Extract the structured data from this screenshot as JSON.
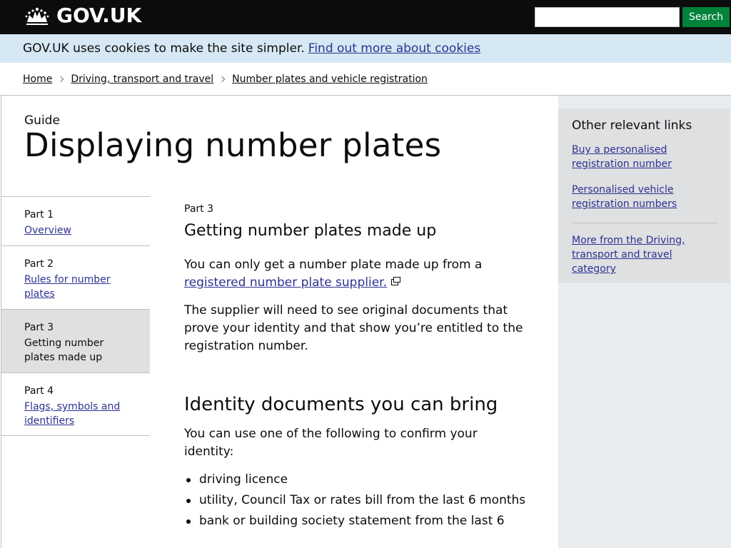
{
  "header": {
    "logo_text": "GOV.UK",
    "search": {
      "placeholder": "",
      "value": "",
      "button_label": "Search"
    }
  },
  "cookie_banner": {
    "text": "GOV.UK uses cookies to make the site simpler.",
    "link": "Find out more about cookies"
  },
  "breadcrumb": {
    "items": [
      "Home",
      "Driving, transport and travel",
      "Number plates and vehicle registration"
    ]
  },
  "title_block": {
    "label": "Guide",
    "title": "Displaying number plates"
  },
  "parts_nav": {
    "items": [
      {
        "part": "Part 1",
        "label": "Overview",
        "current": false
      },
      {
        "part": "Part 2",
        "label": "Rules for number plates",
        "current": false
      },
      {
        "part": "Part 3",
        "label": "Getting number plates made up",
        "current": true
      },
      {
        "part": "Part 4",
        "label": "Flags, symbols and identifiers",
        "current": false
      }
    ]
  },
  "content": {
    "part_label": "Part 3",
    "heading": "Getting number plates made up",
    "para1_text": "You can only get a number plate made up from a",
    "para1_link": "registered number plate supplier.",
    "para2": "The supplier will need to see original documents that prove your identity and that show you’re entitled to the registration number.",
    "heading2": "Identity documents you can bring",
    "para3": "You can use one of the following to confirm your identity:",
    "list": [
      "driving licence",
      "utility, Council Tax or rates bill from the last 6 months",
      "bank or building society statement from the last 6"
    ]
  },
  "related": {
    "title": "Other relevant links",
    "links": [
      "Buy a personalised registration number",
      "Personalised vehicle registration numbers"
    ],
    "more_link": "More from the Driving, transport and travel category"
  },
  "colors": {
    "header_bg": "#0b0c0c",
    "search_button": "#00823b",
    "cookie_bg": "#d5e8f3",
    "link": "#2e3191",
    "sidebar_bg": "#e8ecee",
    "related_bg": "#dee0e2"
  }
}
